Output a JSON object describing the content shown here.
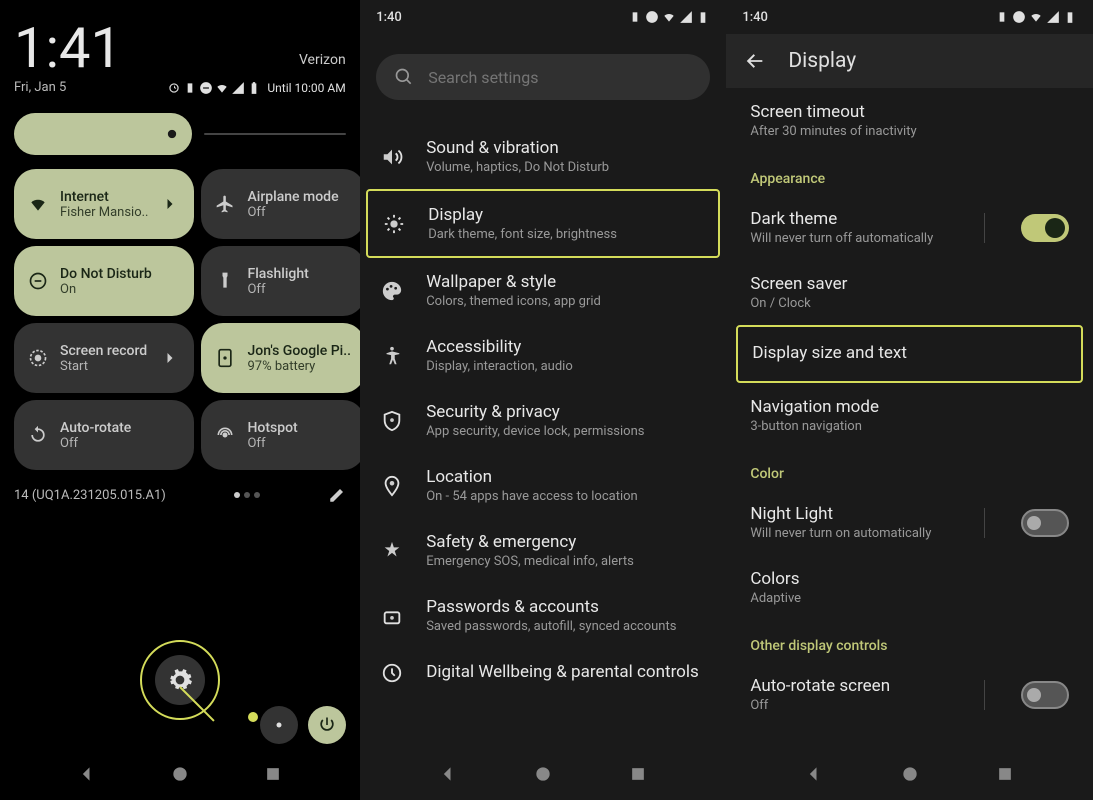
{
  "panel1": {
    "clock": "1:41",
    "carrier": "Verizon",
    "date": "Fri, Jan 5",
    "until": "Until 10:00 AM",
    "tiles": [
      {
        "title": "Internet",
        "sub": "Fisher Mansio..",
        "active": true,
        "chevron": true,
        "icon": "wifi"
      },
      {
        "title": "Airplane mode",
        "sub": "Off",
        "active": false,
        "icon": "airplane"
      },
      {
        "title": "Do Not Disturb",
        "sub": "On",
        "active": true,
        "icon": "dnd"
      },
      {
        "title": "Flashlight",
        "sub": "Off",
        "active": false,
        "icon": "flashlight"
      },
      {
        "title": "Screen record",
        "sub": "Start",
        "active": false,
        "chevron": true,
        "icon": "record"
      },
      {
        "title": "Jon's Google Pi..",
        "sub": "97% battery",
        "active": true,
        "icon": "device"
      },
      {
        "title": "Auto-rotate",
        "sub": "Off",
        "active": false,
        "icon": "rotate"
      },
      {
        "title": "Hotspot",
        "sub": "Off",
        "active": false,
        "icon": "hotspot"
      }
    ],
    "build": "14 (UQ1A.231205.015.A1)"
  },
  "panel2": {
    "time": "1:40",
    "search_placeholder": "Search settings",
    "items": [
      {
        "title": "Sound & vibration",
        "sub": "Volume, haptics, Do Not Disturb",
        "icon": "volume"
      },
      {
        "title": "Display",
        "sub": "Dark theme, font size, brightness",
        "icon": "brightness",
        "highlighted": true
      },
      {
        "title": "Wallpaper & style",
        "sub": "Colors, themed icons, app grid",
        "icon": "palette"
      },
      {
        "title": "Accessibility",
        "sub": "Display, interaction, audio",
        "icon": "accessibility"
      },
      {
        "title": "Security & privacy",
        "sub": "App security, device lock, permissions",
        "icon": "shield"
      },
      {
        "title": "Location",
        "sub": "On - 54 apps have access to location",
        "icon": "location"
      },
      {
        "title": "Safety & emergency",
        "sub": "Emergency SOS, medical info, alerts",
        "icon": "emergency"
      },
      {
        "title": "Passwords & accounts",
        "sub": "Saved passwords, autofill, synced accounts",
        "icon": "key"
      },
      {
        "title": "Digital Wellbeing & parental controls",
        "sub": "",
        "icon": "wellbeing"
      }
    ]
  },
  "panel3": {
    "time": "1:40",
    "title": "Display",
    "items": [
      {
        "type": "row",
        "title": "Screen timeout",
        "sub": "After 30 minutes of inactivity"
      },
      {
        "type": "section",
        "label": "Appearance"
      },
      {
        "type": "toggle_row",
        "title": "Dark theme",
        "sub": "Will never turn off automatically",
        "on": true
      },
      {
        "type": "row",
        "title": "Screen saver",
        "sub": "On / Clock"
      },
      {
        "type": "row",
        "title": "Display size and text",
        "sub": "",
        "highlighted": true
      },
      {
        "type": "row",
        "title": "Navigation mode",
        "sub": "3-button navigation"
      },
      {
        "type": "section",
        "label": "Color"
      },
      {
        "type": "toggle_row",
        "title": "Night Light",
        "sub": "Will never turn on automatically",
        "on": false
      },
      {
        "type": "row",
        "title": "Colors",
        "sub": "Adaptive"
      },
      {
        "type": "section",
        "label": "Other display controls"
      },
      {
        "type": "toggle_row",
        "title": "Auto-rotate screen",
        "sub": "Off",
        "on": false
      }
    ]
  }
}
